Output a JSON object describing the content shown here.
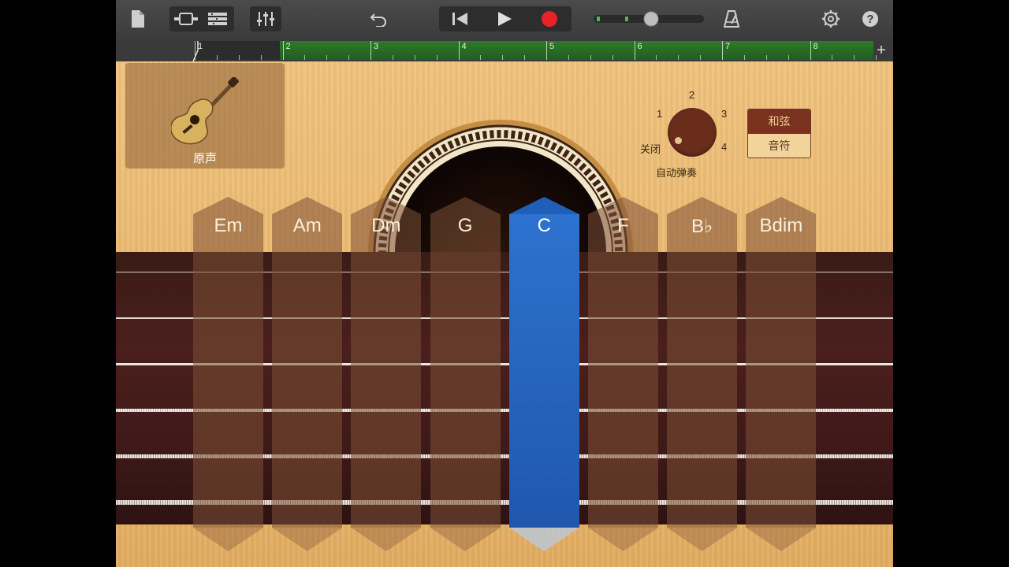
{
  "instrument": {
    "name": "原声"
  },
  "ruler": {
    "bars": [
      "1",
      "2",
      "3",
      "4",
      "5",
      "6",
      "7",
      "8"
    ],
    "add": "+"
  },
  "autoplay": {
    "label": "自动弹奏",
    "positions": [
      "关闭",
      "1",
      "2",
      "3",
      "4"
    ],
    "selected": "关闭"
  },
  "mode": {
    "chords": "和弦",
    "notes": "音符",
    "selected": "和弦"
  },
  "chords": [
    "Em",
    "Am",
    "Dm",
    "G",
    "C",
    "F",
    "B♭",
    "Bdim"
  ],
  "active_chord": "C",
  "colors": {
    "record": "#e8222a",
    "active_chord": "#1f5fb8",
    "wood": "#e8b46a"
  }
}
